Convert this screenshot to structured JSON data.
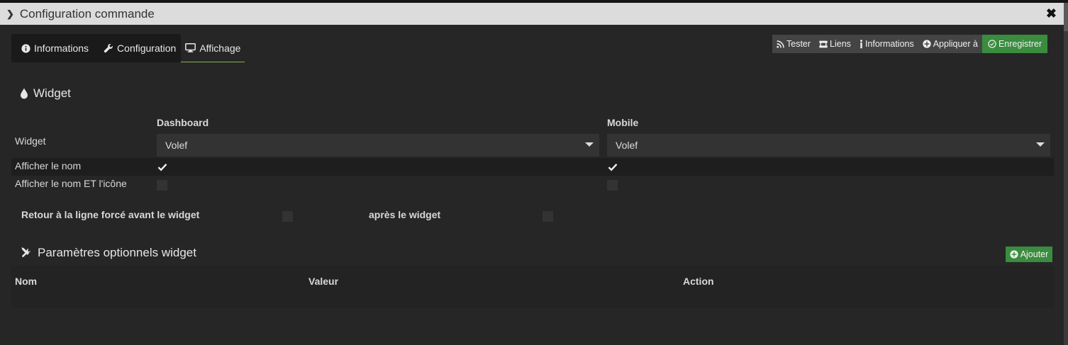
{
  "window": {
    "title": "Configuration commande",
    "collapse_icon": "chevron-right-icon",
    "close_icon": "close-icon"
  },
  "tabs": [
    {
      "label": "Informations",
      "icon": "info-circle-icon",
      "active": false
    },
    {
      "label": "Configuration",
      "icon": "wrench-icon",
      "active": false
    },
    {
      "label": "Affichage",
      "icon": "desktop-icon",
      "active": true
    }
  ],
  "toolbar": [
    {
      "label": "Tester",
      "icon": "rss-icon"
    },
    {
      "label": "Liens",
      "icon": "sitemap-icon"
    },
    {
      "label": "Informations",
      "icon": "info-icon"
    },
    {
      "label": "Appliquer à",
      "icon": "plus-circle-icon"
    },
    {
      "label": "Enregistrer",
      "icon": "check-circle-icon",
      "color": "#3a8c3e"
    }
  ],
  "widget_section": {
    "title": "Widget",
    "icon": "tint-icon",
    "col_dashboard": "Dashboard",
    "col_mobile": "Mobile",
    "row_widget": "Widget",
    "dashboard_widget": "Volef",
    "mobile_widget": "Volef",
    "row_show_name": "Afficher le nom",
    "show_name_dashboard": true,
    "show_name_mobile": true,
    "row_show_name_icon": "Afficher le nom ET l'icône",
    "show_name_icon_dashboard": false,
    "show_name_icon_mobile": false,
    "linebreak_before": "Retour à la ligne forcé avant le widget",
    "linebreak_before_checked": false,
    "linebreak_after": "après le widget",
    "linebreak_after_checked": false
  },
  "optional_params": {
    "title": "Paramètres optionnels widget",
    "icon": "tools-icon",
    "add_label": "Ajouter",
    "columns": [
      "Nom",
      "Valeur",
      "Action"
    ]
  },
  "colors": {
    "accent": "#8ab04e",
    "success": "#3a8c3e",
    "background": "#262626"
  }
}
